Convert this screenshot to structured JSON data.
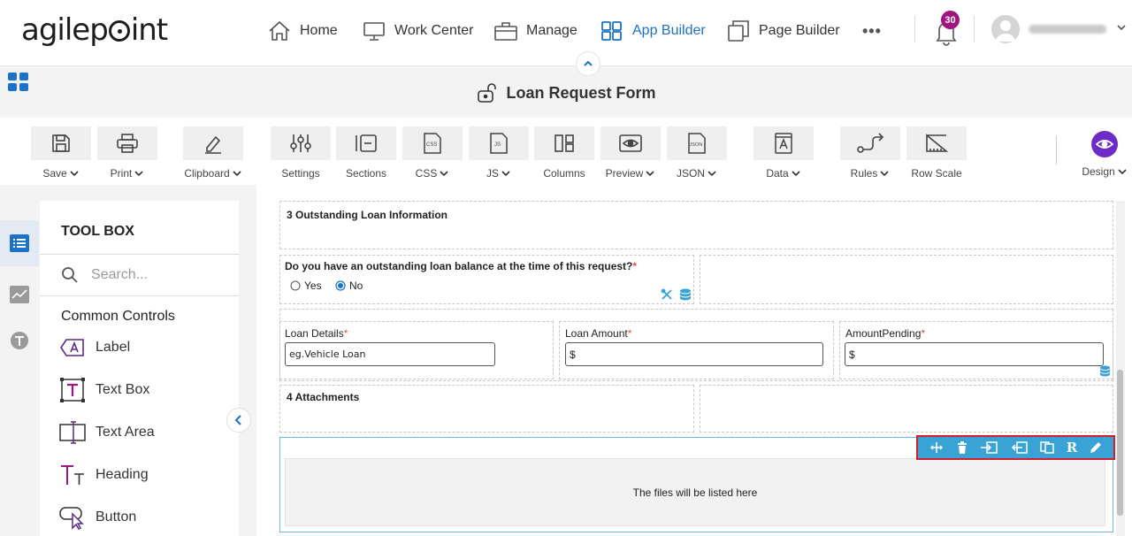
{
  "app": {
    "brand_part1": "agilep",
    "brand_part2": "int"
  },
  "nav": {
    "items": [
      {
        "label": "Home",
        "icon": "home-icon"
      },
      {
        "label": "Work Center",
        "icon": "monitor-icon"
      },
      {
        "label": "Manage",
        "icon": "briefcase-icon"
      },
      {
        "label": "App Builder",
        "icon": "grid-icon",
        "active": true
      },
      {
        "label": "Page Builder",
        "icon": "pages-icon"
      }
    ],
    "more": "•••",
    "notifications": "30"
  },
  "form": {
    "title": "Loan Request Form"
  },
  "ribbon": {
    "buttons": [
      {
        "label": "Save",
        "dropdown": true,
        "icon": "save-icon"
      },
      {
        "label": "Print",
        "dropdown": true,
        "icon": "print-icon"
      },
      {
        "label": "Clipboard",
        "dropdown": true,
        "icon": "pencil-icon"
      },
      {
        "label": "Settings",
        "dropdown": false,
        "icon": "sliders-icon"
      },
      {
        "label": "Sections",
        "dropdown": false,
        "icon": "sections-icon"
      },
      {
        "label": "CSS",
        "dropdown": true,
        "icon": "css-file-icon"
      },
      {
        "label": "JS",
        "dropdown": true,
        "icon": "js-file-icon"
      },
      {
        "label": "Columns",
        "dropdown": false,
        "icon": "columns-icon"
      },
      {
        "label": "Preview",
        "dropdown": true,
        "icon": "eye-icon"
      },
      {
        "label": "JSON",
        "dropdown": true,
        "icon": "json-file-icon"
      },
      {
        "label": "Data",
        "dropdown": true,
        "icon": "data-icon"
      },
      {
        "label": "Rules",
        "dropdown": true,
        "icon": "rules-icon"
      },
      {
        "label": "Row Scale",
        "dropdown": false,
        "icon": "row-scale-icon"
      }
    ],
    "design_label": "Design"
  },
  "toolbox": {
    "title": "TOOL BOX",
    "search_placeholder": "Search...",
    "section": "Common Controls",
    "tools": [
      {
        "label": "Label",
        "icon": "label-icon"
      },
      {
        "label": "Text Box",
        "icon": "textbox-icon"
      },
      {
        "label": "Text Area",
        "icon": "textarea-icon"
      },
      {
        "label": "Heading",
        "icon": "heading-icon"
      },
      {
        "label": "Button",
        "icon": "button-icon"
      }
    ]
  },
  "canvas": {
    "section3_title": "3 Outstanding Loan Information",
    "question": "Do you have an outstanding loan balance at the time of this request?",
    "radio_yes": "Yes",
    "radio_no": "No",
    "radio_selected": "No",
    "loan_details_label": "Loan Details",
    "loan_details_value": "eg.Vehicle Loan",
    "loan_amount_label": "Loan Amount",
    "loan_amount_value": "$",
    "amount_pending_label": "AmountPending",
    "amount_pending_value": "$",
    "section4_title": "4 Attachments",
    "files_placeholder": "The files will be listed here",
    "required_mark": "*"
  },
  "colors": {
    "accent": "#1a73c8",
    "purple": "#6c2dc7",
    "badge": "#a0157e",
    "toolbar_bg": "#3aa3d6",
    "highlight": "#d21f2b"
  }
}
